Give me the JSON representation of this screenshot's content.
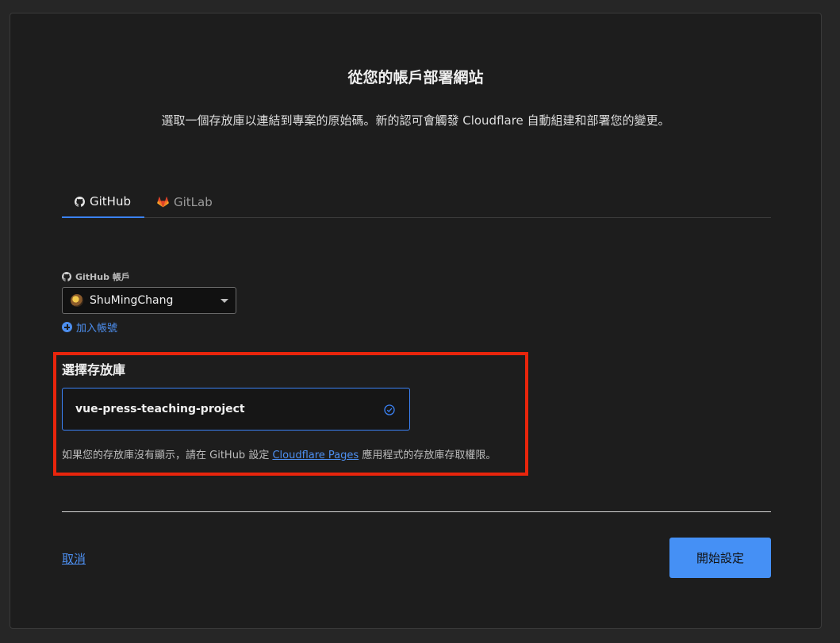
{
  "header": {
    "title": "從您的帳戶部署網站",
    "subtitle": "選取一個存放庫以連結到專案的原始碼。新的認可會觸發 Cloudflare 自動組建和部署您的變更。"
  },
  "tabs": [
    {
      "label": "GitHub",
      "icon": "github-icon",
      "active": true
    },
    {
      "label": "GitLab",
      "icon": "gitlab-icon",
      "active": false
    }
  ],
  "account": {
    "label": "GitHub 帳戶",
    "selected": "ShuMingChang",
    "add_label": "加入帳號"
  },
  "repository": {
    "heading": "選擇存放庫",
    "selected": "vue-press-teaching-project",
    "help_prefix": "如果您的存放庫沒有顯示，請在 GitHub 設定 ",
    "help_link": "Cloudflare Pages",
    "help_suffix": " 應用程式的存放庫存取權限。"
  },
  "footer": {
    "cancel_label": "取消",
    "start_label": "開始設定"
  },
  "colors": {
    "accent": "#3b82f6",
    "highlight": "#e8250c",
    "background": "#1d1d1d"
  }
}
